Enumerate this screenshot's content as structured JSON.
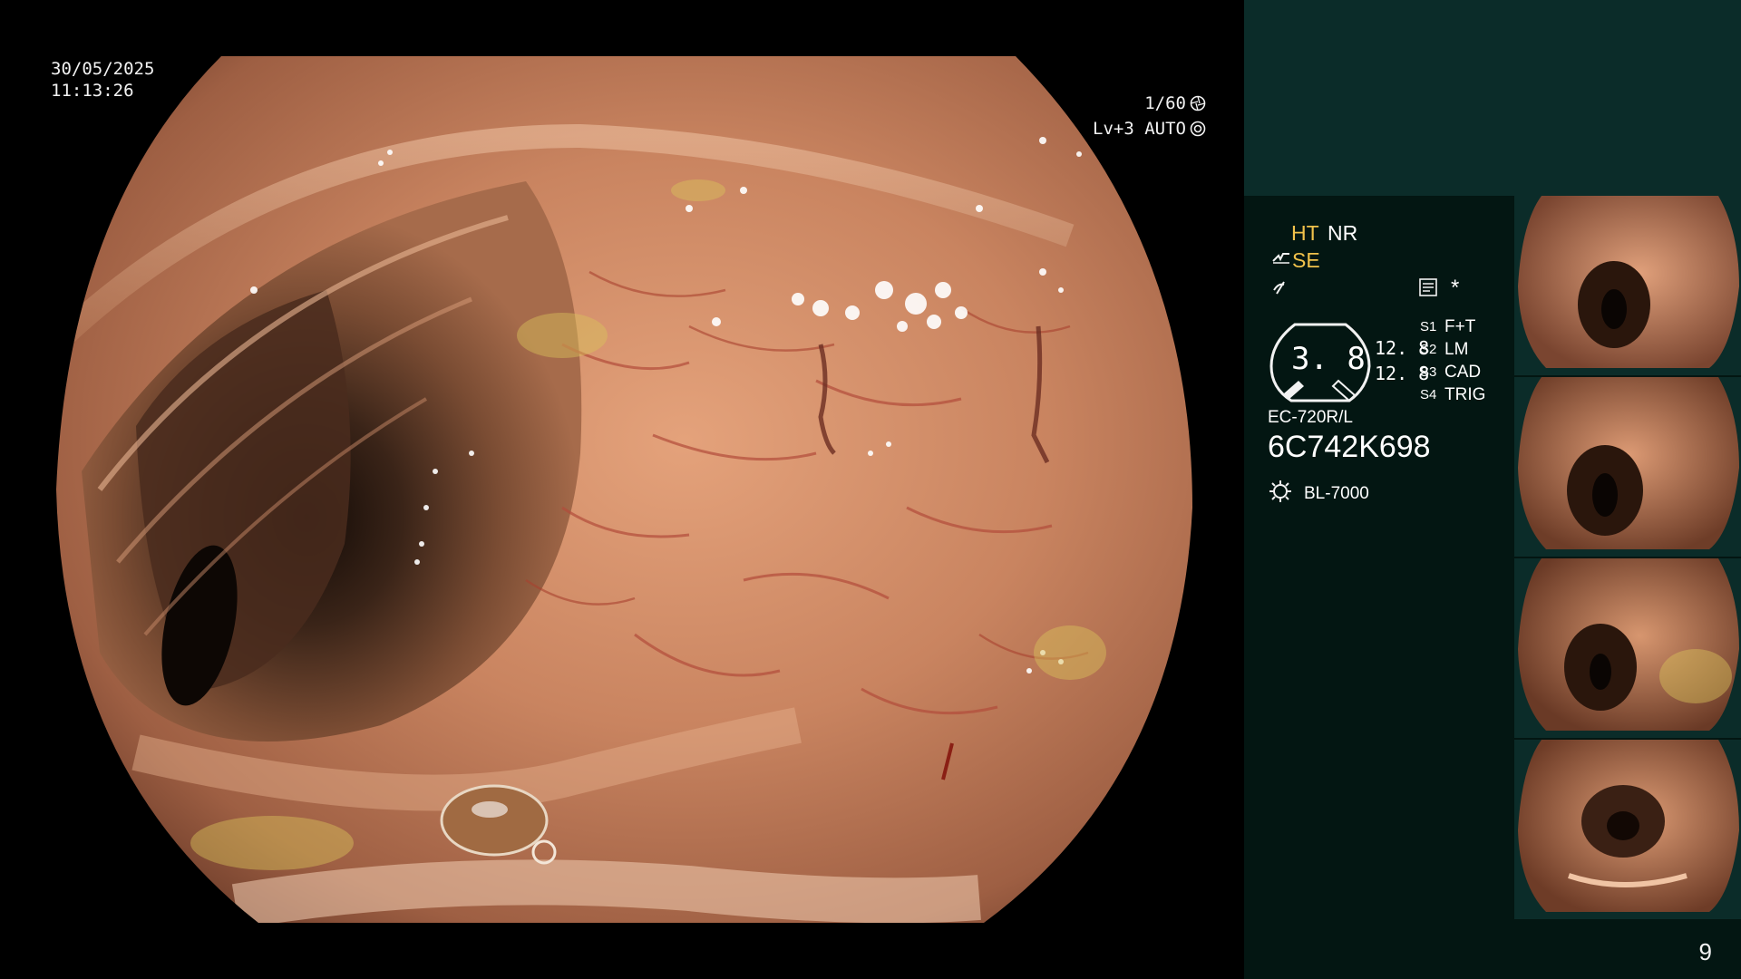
{
  "overlay": {
    "date": "30/05/2025",
    "time": "11:13:26",
    "shutter": "1/60",
    "level": "Lv+3 AUTO"
  },
  "settings": {
    "ht": "HT",
    "nr": "NR",
    "se": "SE",
    "ratio_big": "3. 8",
    "ratio_a": "12. 8",
    "ratio_b": "12. 8",
    "s1_key": "S1",
    "s1_val": "F+T",
    "s2_key": "S2",
    "s2_val": "LM",
    "s3_key": "S3",
    "s3_val": "CAD",
    "s4_key": "S4",
    "s4_val": "TRIG",
    "star": "*",
    "scope_model": "EC-720R/L",
    "scope_serial": "6C742K698",
    "light_source": "BL-7000"
  },
  "page_number": "9",
  "colors": {
    "accent_yellow": "#f1c24b",
    "panel_dark": "#031612",
    "panel_teal": "#0b2c29",
    "mucosa": "#c98460"
  },
  "icons": [
    "iris-icon",
    "auto-iris-icon",
    "enhancement-icon",
    "color-mode-icon",
    "memo-icon",
    "ratio-gauge-icon",
    "lamp-icon"
  ]
}
